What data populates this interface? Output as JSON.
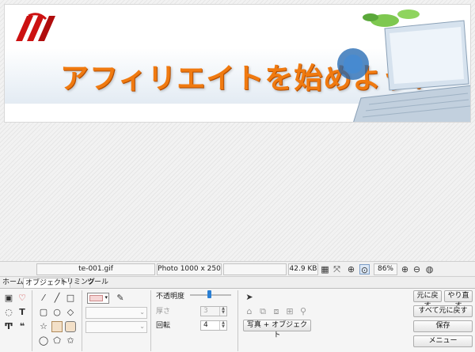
{
  "banner": {
    "title": "アフィリエイトを始めよう！",
    "accent_color": "#f07a10",
    "logo_color": "#cc1111"
  },
  "statusbar": {
    "filename": "te-001.gif",
    "dimensions": "Photo 1000 x 250",
    "filesize": "42.9 KB",
    "zoom": "86%"
  },
  "tabs": [
    {
      "label": "ホーム"
    },
    {
      "label": "オブジェクト",
      "active": true
    },
    {
      "label": "トリミング"
    },
    {
      "label": "ツール"
    }
  ],
  "panel": {
    "opacity_label": "不透明度",
    "thickness_label": "厚さ",
    "thickness_value": "3",
    "rotation_label": "回転",
    "rotation_value": "4",
    "photo_object_button": "写真 + オブジェクト"
  },
  "actions": {
    "undo": "元に戻す",
    "redo": "やり直す",
    "undo_all": "すべて元に戻す",
    "save": "保存",
    "menu": "メニュー"
  }
}
